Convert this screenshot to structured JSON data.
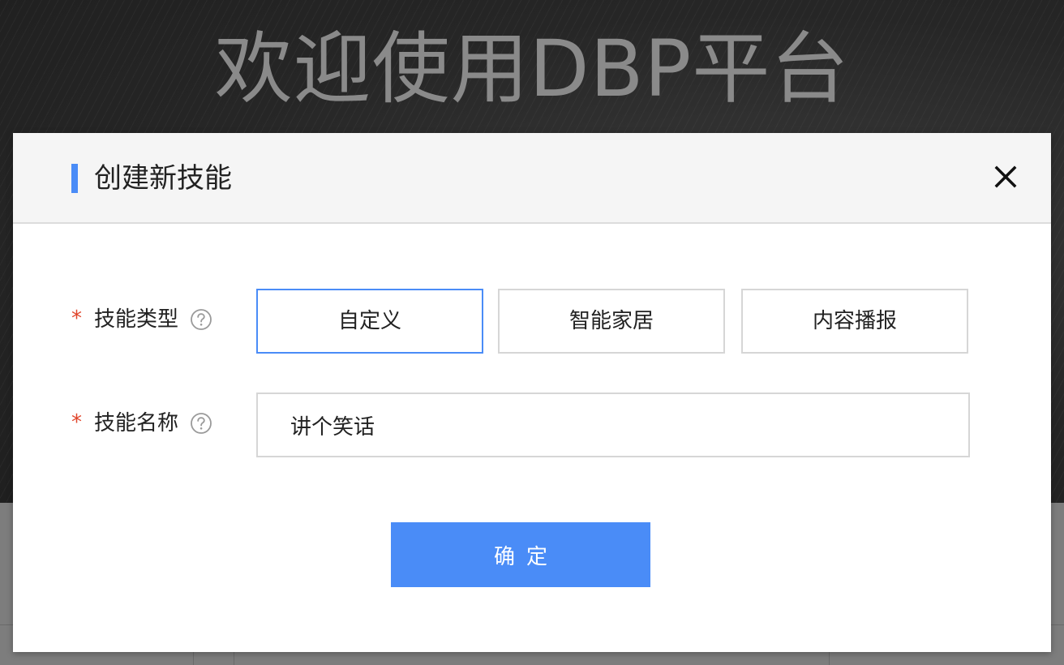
{
  "background": {
    "hero_title": "欢迎使用DBP平台"
  },
  "dialog": {
    "title": "创建新技能",
    "close_icon": "close-icon",
    "skill_type": {
      "required_mark": "*",
      "label": "技能类型",
      "help_icon": "question-circle-icon",
      "options": [
        {
          "label": "自定义",
          "selected": true
        },
        {
          "label": "智能家居",
          "selected": false
        },
        {
          "label": "内容播报",
          "selected": false
        }
      ]
    },
    "skill_name": {
      "required_mark": "*",
      "label": "技能名称",
      "help_icon": "question-circle-icon",
      "value": "讲个笑话"
    },
    "confirm_label": "确定"
  },
  "colors": {
    "accent": "#4a8cf7",
    "required": "#e0452b",
    "header_bg": "#f5f5f5",
    "border": "#d6d6d6"
  }
}
